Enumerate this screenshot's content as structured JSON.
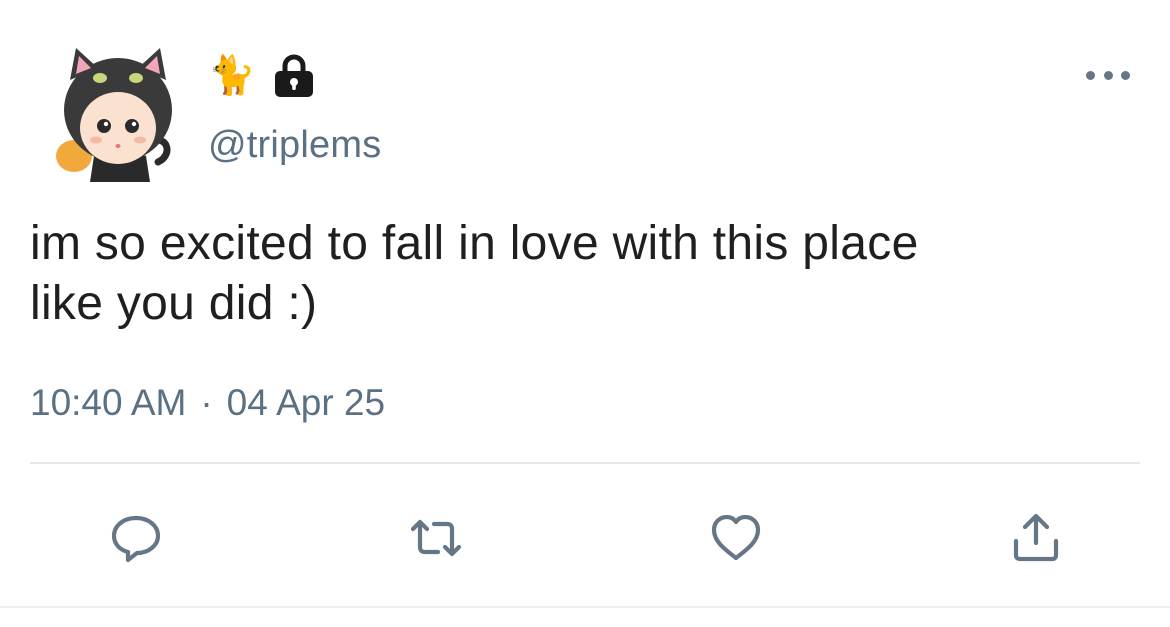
{
  "user": {
    "display_name_emoji": "🐈",
    "protected_icon": "lock-icon",
    "handle": "@triplems",
    "avatar": "avatar-doll-in-black-cat-hood"
  },
  "tweet": {
    "text": "im so excited to fall in love with this place\nlike you did :)",
    "time": "10:40 AM",
    "separator": "·",
    "date": "04 Apr 25"
  },
  "actions": [
    {
      "name": "reply",
      "icon": "comment-bubble-icon"
    },
    {
      "name": "retweet",
      "icon": "retweet-icon"
    },
    {
      "name": "like",
      "icon": "heart-icon"
    },
    {
      "name": "share",
      "icon": "share-icon"
    }
  ],
  "colors": {
    "text": "#1f1f1f",
    "secondary": "#5b7083",
    "icon": "#657786",
    "divider": "#e3e8ec"
  }
}
